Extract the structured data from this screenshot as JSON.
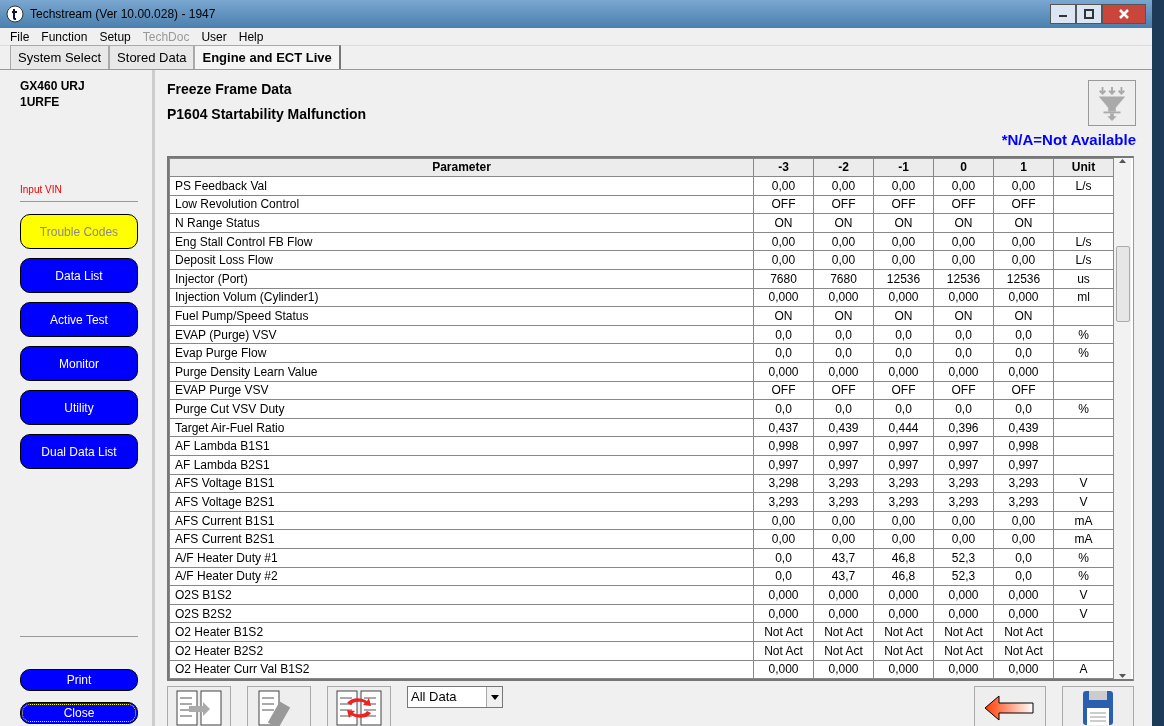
{
  "window": {
    "title": "Techstream (Ver 10.00.028) - 1947"
  },
  "menu": [
    {
      "label": "File",
      "disabled": false
    },
    {
      "label": "Function",
      "disabled": false
    },
    {
      "label": "Setup",
      "disabled": false
    },
    {
      "label": "TechDoc",
      "disabled": true
    },
    {
      "label": "User",
      "disabled": false
    },
    {
      "label": "Help",
      "disabled": false
    }
  ],
  "tabs": [
    {
      "label": "System Select",
      "selected": false
    },
    {
      "label": "Stored Data",
      "selected": false
    },
    {
      "label": "Engine and ECT Live",
      "selected": true
    }
  ],
  "sidebar": {
    "vehicle": [
      "GX460 URJ",
      "1URFE"
    ],
    "vin_link": "Input VIN",
    "buttons": [
      {
        "label": "Trouble Codes",
        "selected": true
      },
      {
        "label": "Data List",
        "selected": false
      },
      {
        "label": "Active Test",
        "selected": false
      },
      {
        "label": "Monitor",
        "selected": false
      },
      {
        "label": "Utility",
        "selected": false
      },
      {
        "label": "Dual Data List",
        "selected": false
      }
    ],
    "bottom_buttons": [
      {
        "label": "Print",
        "focused": false
      },
      {
        "label": "Close",
        "focused": true
      }
    ]
  },
  "main": {
    "title": "Freeze Frame Data",
    "subtitle": "P1604 Startability Malfunction",
    "note": "*N/A=Not Available",
    "table": {
      "columns": [
        "Parameter",
        "-3",
        "-2",
        "-1",
        "0",
        "1",
        "Unit"
      ],
      "rows": [
        [
          "PS Feedback Val",
          "0,00",
          "0,00",
          "0,00",
          "0,00",
          "0,00",
          "L/s"
        ],
        [
          "Low Revolution Control",
          "OFF",
          "OFF",
          "OFF",
          "OFF",
          "OFF",
          ""
        ],
        [
          "N Range Status",
          "ON",
          "ON",
          "ON",
          "ON",
          "ON",
          ""
        ],
        [
          "Eng Stall Control FB Flow",
          "0,00",
          "0,00",
          "0,00",
          "0,00",
          "0,00",
          "L/s"
        ],
        [
          "Deposit Loss Flow",
          "0,00",
          "0,00",
          "0,00",
          "0,00",
          "0,00",
          "L/s"
        ],
        [
          "Injector (Port)",
          "7680",
          "7680",
          "12536",
          "12536",
          "12536",
          "us"
        ],
        [
          "Injection Volum (Cylinder1)",
          "0,000",
          "0,000",
          "0,000",
          "0,000",
          "0,000",
          "ml"
        ],
        [
          "Fuel Pump/Speed Status",
          "ON",
          "ON",
          "ON",
          "ON",
          "ON",
          ""
        ],
        [
          "EVAP (Purge) VSV",
          "0,0",
          "0,0",
          "0,0",
          "0,0",
          "0,0",
          "%"
        ],
        [
          "Evap Purge Flow",
          "0,0",
          "0,0",
          "0,0",
          "0,0",
          "0,0",
          "%"
        ],
        [
          "Purge Density Learn Value",
          "0,000",
          "0,000",
          "0,000",
          "0,000",
          "0,000",
          ""
        ],
        [
          "EVAP Purge VSV",
          "OFF",
          "OFF",
          "OFF",
          "OFF",
          "OFF",
          ""
        ],
        [
          "Purge Cut VSV Duty",
          "0,0",
          "0,0",
          "0,0",
          "0,0",
          "0,0",
          "%"
        ],
        [
          "Target Air-Fuel Ratio",
          "0,437",
          "0,439",
          "0,444",
          "0,396",
          "0,439",
          ""
        ],
        [
          "AF Lambda B1S1",
          "0,998",
          "0,997",
          "0,997",
          "0,997",
          "0,998",
          ""
        ],
        [
          "AF Lambda B2S1",
          "0,997",
          "0,997",
          "0,997",
          "0,997",
          "0,997",
          ""
        ],
        [
          "AFS Voltage B1S1",
          "3,298",
          "3,293",
          "3,293",
          "3,293",
          "3,293",
          "V"
        ],
        [
          "AFS Voltage B2S1",
          "3,293",
          "3,293",
          "3,293",
          "3,293",
          "3,293",
          "V"
        ],
        [
          "AFS Current B1S1",
          "0,00",
          "0,00",
          "0,00",
          "0,00",
          "0,00",
          "mA"
        ],
        [
          "AFS Current B2S1",
          "0,00",
          "0,00",
          "0,00",
          "0,00",
          "0,00",
          "mA"
        ],
        [
          "A/F Heater Duty #1",
          "0,0",
          "43,7",
          "46,8",
          "52,3",
          "0,0",
          "%"
        ],
        [
          "A/F Heater Duty #2",
          "0,0",
          "43,7",
          "46,8",
          "52,3",
          "0,0",
          "%"
        ],
        [
          "O2S B1S2",
          "0,000",
          "0,000",
          "0,000",
          "0,000",
          "0,000",
          "V"
        ],
        [
          "O2S B2S2",
          "0,000",
          "0,000",
          "0,000",
          "0,000",
          "0,000",
          "V"
        ],
        [
          "O2 Heater B1S2",
          "Not Act",
          "Not Act",
          "Not Act",
          "Not Act",
          "Not Act",
          ""
        ],
        [
          "O2 Heater B2S2",
          "Not Act",
          "Not Act",
          "Not Act",
          "Not Act",
          "Not Act",
          ""
        ],
        [
          "O2 Heater Curr Val B1S2",
          "0,000",
          "0,000",
          "0,000",
          "0,000",
          "0,000",
          "A"
        ]
      ]
    },
    "filter_select": {
      "value": "All Data"
    }
  }
}
